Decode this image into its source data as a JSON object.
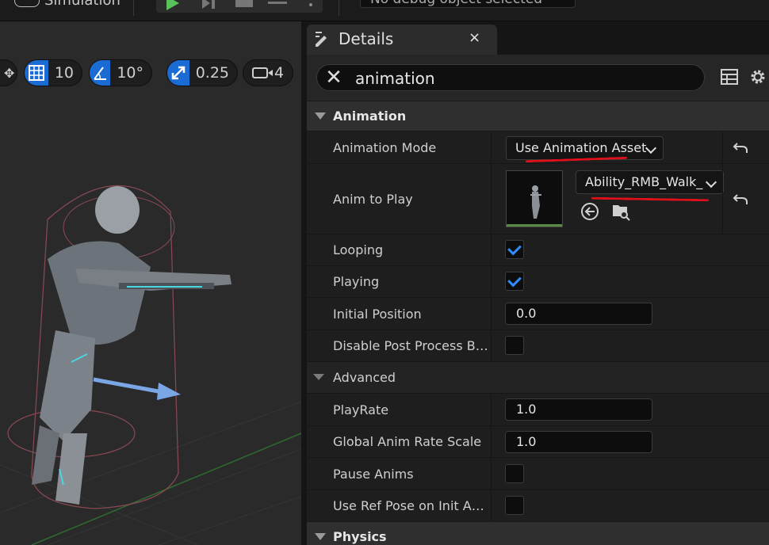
{
  "topbar": {
    "simulation_label": "Simulation",
    "debug_object": "No debug object selected"
  },
  "viewport": {
    "grid_snap": "10",
    "rotation_snap": "10°",
    "scale_snap": "0.25",
    "camera_speed": "4"
  },
  "details": {
    "tab_title": "Details",
    "close_glyph": "×",
    "search": {
      "value": "animation",
      "clear_glyph": "✕"
    },
    "categories": {
      "animation": "Animation",
      "advanced": "Advanced",
      "physics": "Physics"
    },
    "properties": {
      "animation_mode": {
        "label": "Animation Mode",
        "value": "Use Animation Asset"
      },
      "anim_to_play": {
        "label": "Anim to Play",
        "value": "Ability_RMB_Walk_"
      },
      "looping": {
        "label": "Looping",
        "checked": true
      },
      "playing": {
        "label": "Playing",
        "checked": true
      },
      "initial_position": {
        "label": "Initial Position",
        "value": "0.0"
      },
      "disable_post_process": {
        "label": "Disable Post Process Blue...",
        "checked": false
      },
      "play_rate": {
        "label": "PlayRate",
        "value": "1.0"
      },
      "global_anim_rate_scale": {
        "label": "Global Anim Rate Scale",
        "value": "1.0"
      },
      "pause_anims": {
        "label": "Pause Anims",
        "checked": false
      },
      "use_ref_pose": {
        "label": "Use Ref Pose on Init Anim",
        "checked": false
      }
    }
  },
  "colors": {
    "accent_blue": "#1a6bd3",
    "check_blue": "#2f8cff",
    "annotation_red": "#e0101a",
    "play_green": "#58c15a"
  }
}
